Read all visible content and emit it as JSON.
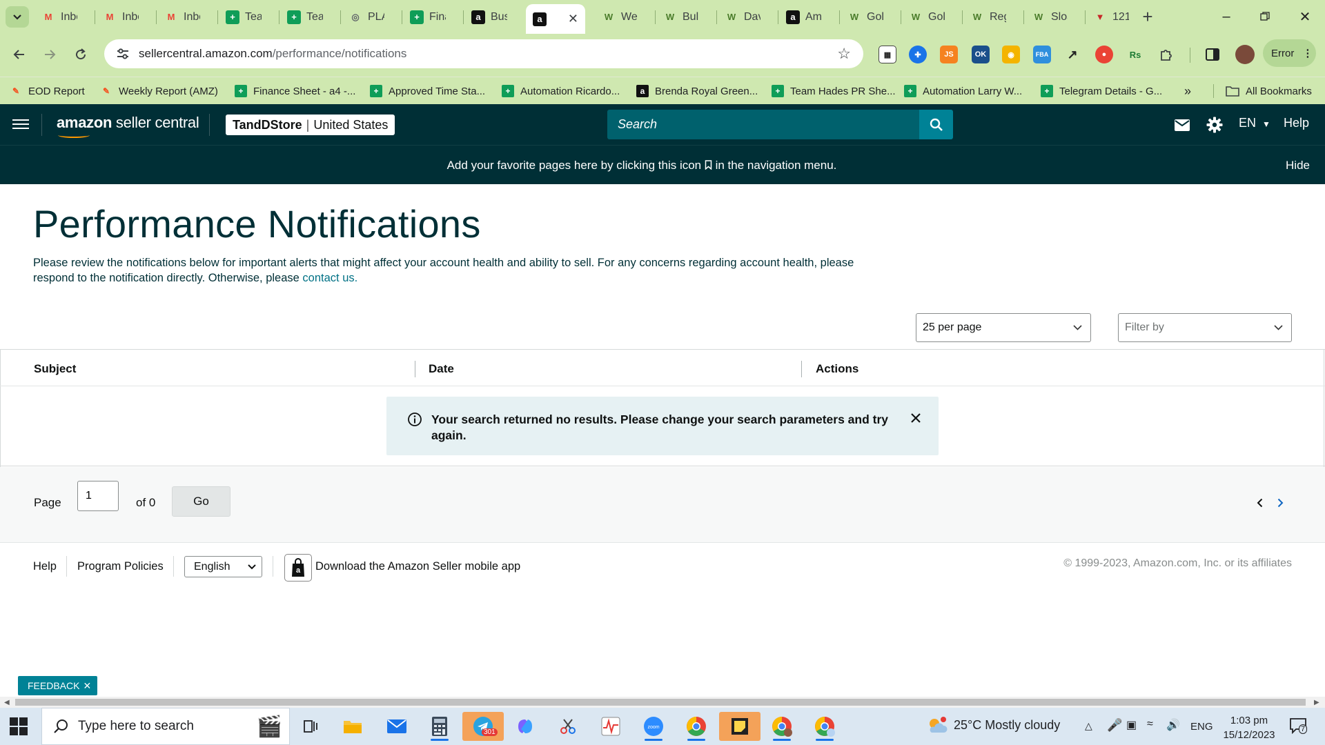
{
  "browser": {
    "tabs": [
      {
        "title": "Inbox",
        "icon": "gmail-icon"
      },
      {
        "title": "Inbox",
        "icon": "gmail-icon"
      },
      {
        "title": "Inbox",
        "icon": "gmail-icon"
      },
      {
        "title": "Team",
        "icon": "google-sheets-icon"
      },
      {
        "title": "Team",
        "icon": "google-sheets-icon"
      },
      {
        "title": "PLAY",
        "icon": "globe-icon"
      },
      {
        "title": "Finance",
        "icon": "google-sheets-icon"
      },
      {
        "title": "Business",
        "icon": "amazon-icon"
      },
      {
        "title": "",
        "icon": "amazon-icon",
        "active": true
      },
      {
        "title": "Web",
        "icon": "w-icon"
      },
      {
        "title": "Bulk",
        "icon": "w-icon"
      },
      {
        "title": "Davi",
        "icon": "w-icon"
      },
      {
        "title": "Ama",
        "icon": "amazon-icon"
      },
      {
        "title": "Gold",
        "icon": "w-icon"
      },
      {
        "title": "Gold",
        "icon": "w-icon"
      },
      {
        "title": "Reg",
        "icon": "w-icon"
      },
      {
        "title": "Sloa",
        "icon": "w-icon"
      },
      {
        "title": "121",
        "icon": "red-v-icon"
      }
    ],
    "url_host": "sellercentral.amazon.com",
    "url_path": "/performance/notifications",
    "profile_button": "Error",
    "bookmarks": [
      {
        "label": "EOD Report",
        "icon": "pen-icon"
      },
      {
        "label": "Weekly Report (AMZ)",
        "icon": "pen-icon"
      },
      {
        "label": "Finance Sheet - a4 -...",
        "icon": "google-sheets-icon"
      },
      {
        "label": "Approved Time Sta...",
        "icon": "google-sheets-icon"
      },
      {
        "label": "Automation Ricardo...",
        "icon": "google-sheets-icon"
      },
      {
        "label": "Brenda Royal Green...",
        "icon": "amazon-icon"
      },
      {
        "label": "Team Hades PR She...",
        "icon": "google-sheets-icon"
      },
      {
        "label": "Automation Larry W...",
        "icon": "google-sheets-icon"
      },
      {
        "label": "Telegram Details - G...",
        "icon": "google-sheets-icon"
      }
    ],
    "all_bookmarks": "All Bookmarks"
  },
  "header": {
    "logo_main": "amazon",
    "logo_sub": "seller central",
    "store_name": "TandDStore",
    "store_region": "United States",
    "search_placeholder": "Search",
    "language": "EN",
    "help": "Help"
  },
  "banner": {
    "message": "Add your favorite pages here by clicking this icon",
    "message_end": "in the navigation menu.",
    "hide": "Hide"
  },
  "main": {
    "title": "Performance Notifications",
    "description": "Please review the notifications below for important alerts that might affect your account health and ability to sell. For any concerns regarding account health, please respond to the notification directly. Otherwise, please",
    "contact_link": "contact us.",
    "per_page": "25 per page",
    "filter_placeholder": "Filter by",
    "columns": [
      "Subject",
      "Date",
      "Actions"
    ],
    "alert_text": "Your search returned no results. Please change your search parameters and try again.",
    "pagination": {
      "page_label": "Page",
      "page_value": "1",
      "of_label": "of 0",
      "go": "Go"
    }
  },
  "footer": {
    "help": "Help",
    "program_policies": "Program Policies",
    "language": "English",
    "app_download": "Download the Amazon Seller mobile app",
    "copyright": "© 1999-2023, Amazon.com, Inc. or its affiliates"
  },
  "feedback": "FEEDBACK",
  "taskbar": {
    "search_placeholder": "Type here to search",
    "telegram_badge": "301",
    "weather": "25°C  Mostly cloudy",
    "input_lang": "ENG",
    "time": "1:03 pm",
    "date": "15/12/2023",
    "notifications": "7"
  }
}
